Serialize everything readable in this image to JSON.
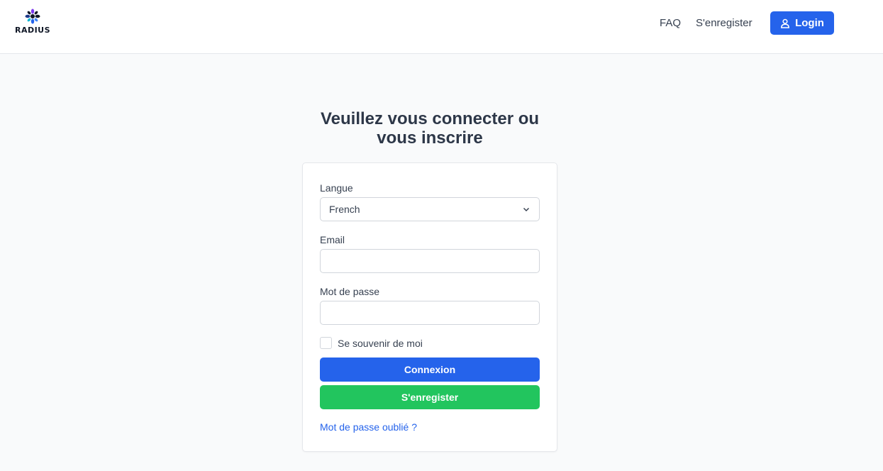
{
  "header": {
    "logo_text": "RADIUS",
    "logo_icon": "radius-flower-icon",
    "nav": {
      "faq": "FAQ",
      "register": "S'enregister",
      "login": "Login"
    }
  },
  "main": {
    "title": "Veuillez vous connecter ou vous inscrire"
  },
  "form": {
    "language_label": "Langue",
    "language_value": "French",
    "email_label": "Email",
    "email_value": "",
    "password_label": "Mot de passe",
    "password_value": "",
    "remember_label": "Se souvenir de moi",
    "remember_checked": false,
    "connect_label": "Connexion",
    "register_label": "S'enregister",
    "forgot_label": "Mot de passe oublié ?"
  },
  "colors": {
    "primary": "#2563eb",
    "success": "#22c55e",
    "background": "#f9fafb",
    "text": "#374151"
  }
}
